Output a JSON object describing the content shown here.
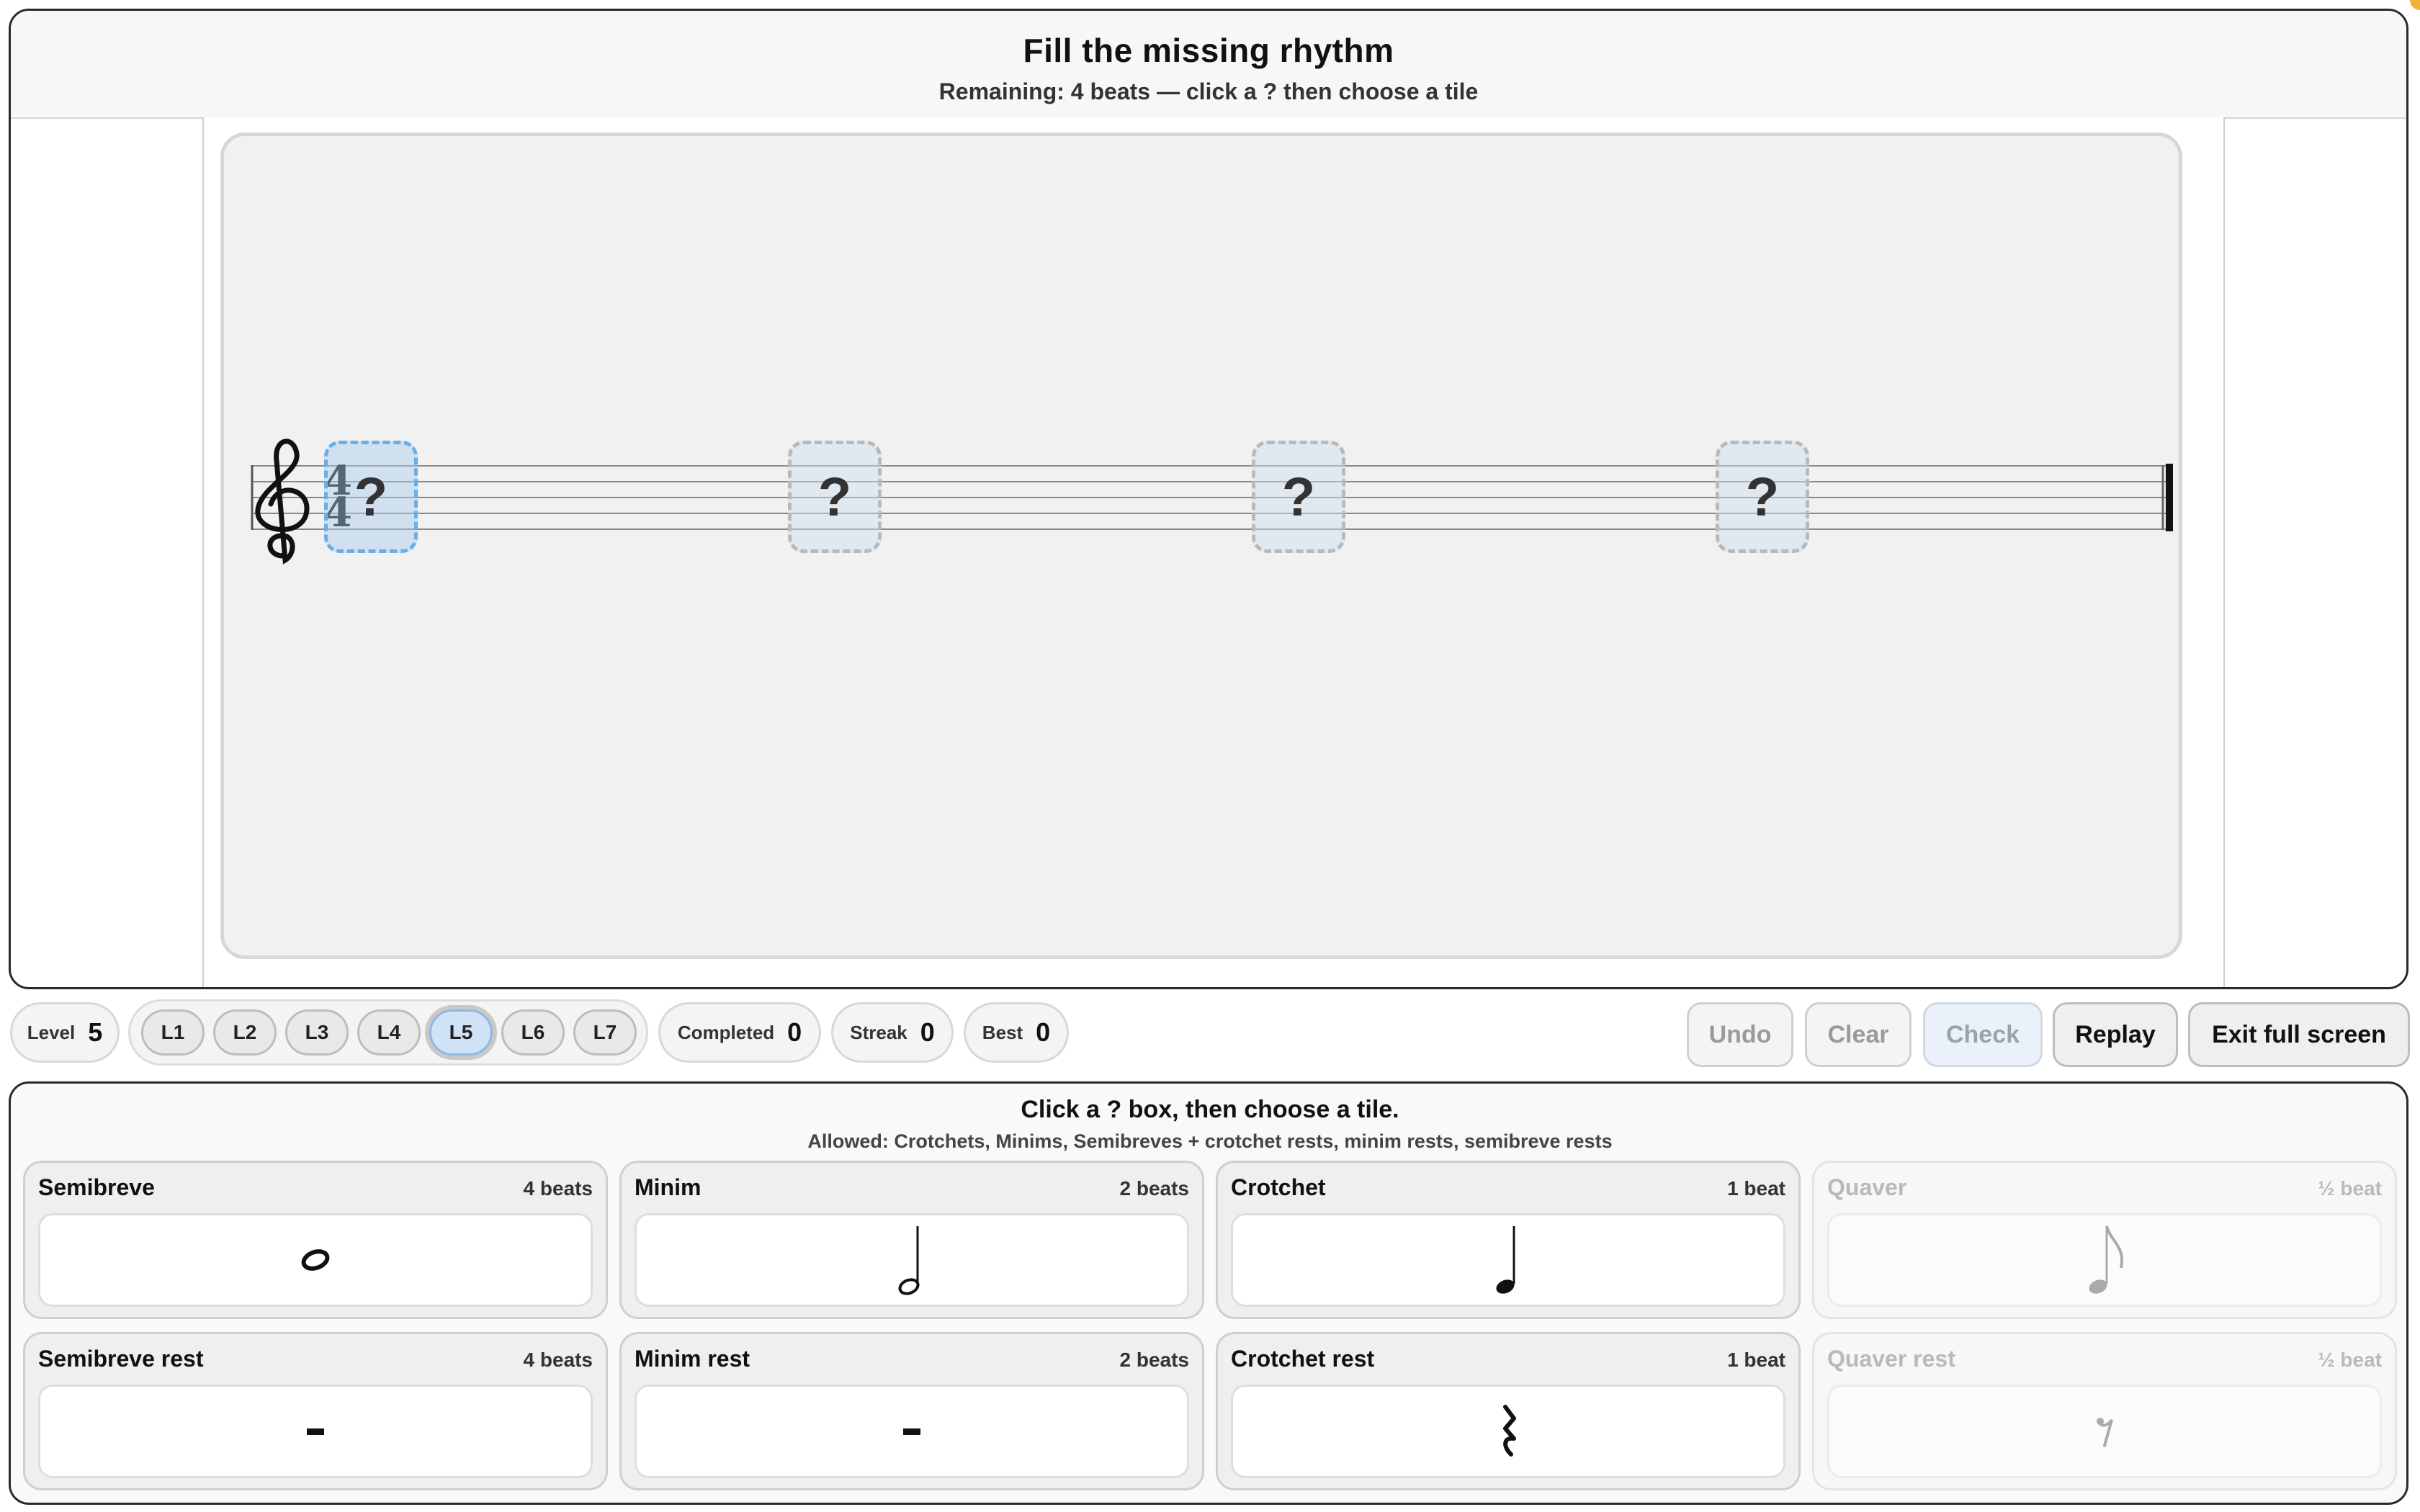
{
  "header": {
    "title": "Fill the missing rhythm",
    "subtitle": "Remaining: 4 beats — click a ? then choose a tile"
  },
  "staff": {
    "clef": "treble-clef-icon",
    "time_signature": {
      "top": "4",
      "bottom": "4"
    },
    "slots": [
      {
        "label": "?",
        "active": true
      },
      {
        "label": "?",
        "active": false
      },
      {
        "label": "?",
        "active": false
      },
      {
        "label": "?",
        "active": false
      }
    ]
  },
  "toolbar": {
    "level_label": "Level",
    "level_value": "5",
    "levels": [
      "L1",
      "L2",
      "L3",
      "L4",
      "L5",
      "L6",
      "L7"
    ],
    "selected_level": "L5",
    "completed_label": "Completed",
    "completed_value": "0",
    "streak_label": "Streak",
    "streak_value": "0",
    "best_label": "Best",
    "best_value": "0",
    "undo_label": "Undo",
    "clear_label": "Clear",
    "check_label": "Check",
    "replay_label": "Replay",
    "exit_label": "Exit full screen"
  },
  "palette": {
    "title": "Click a ? box, then choose a tile.",
    "subtitle": "Allowed: Crotchets, Minims, Semibreves + crotchet rests, minim rests, semibreve rests",
    "tiles": [
      {
        "name": "Semibreve",
        "beats": "4 beats",
        "icon": "semibreve-note-icon",
        "enabled": true
      },
      {
        "name": "Minim",
        "beats": "2 beats",
        "icon": "minim-note-icon",
        "enabled": true
      },
      {
        "name": "Crotchet",
        "beats": "1 beat",
        "icon": "crotchet-note-icon",
        "enabled": true
      },
      {
        "name": "Quaver",
        "beats": "½ beat",
        "icon": "quaver-note-icon",
        "enabled": false
      },
      {
        "name": "Semibreve rest",
        "beats": "4 beats",
        "icon": "semibreve-rest-icon",
        "enabled": true
      },
      {
        "name": "Minim rest",
        "beats": "2 beats",
        "icon": "minim-rest-icon",
        "enabled": true
      },
      {
        "name": "Crotchet rest",
        "beats": "1 beat",
        "icon": "crotchet-rest-icon",
        "enabled": true
      },
      {
        "name": "Quaver rest",
        "beats": "½ beat",
        "icon": "quaver-rest-icon",
        "enabled": false
      }
    ]
  },
  "colors": {
    "active_slot_border": "#6aaee8",
    "selected_level_fill": "#cfe2f6",
    "disabled_text": "#9a9a9a"
  }
}
